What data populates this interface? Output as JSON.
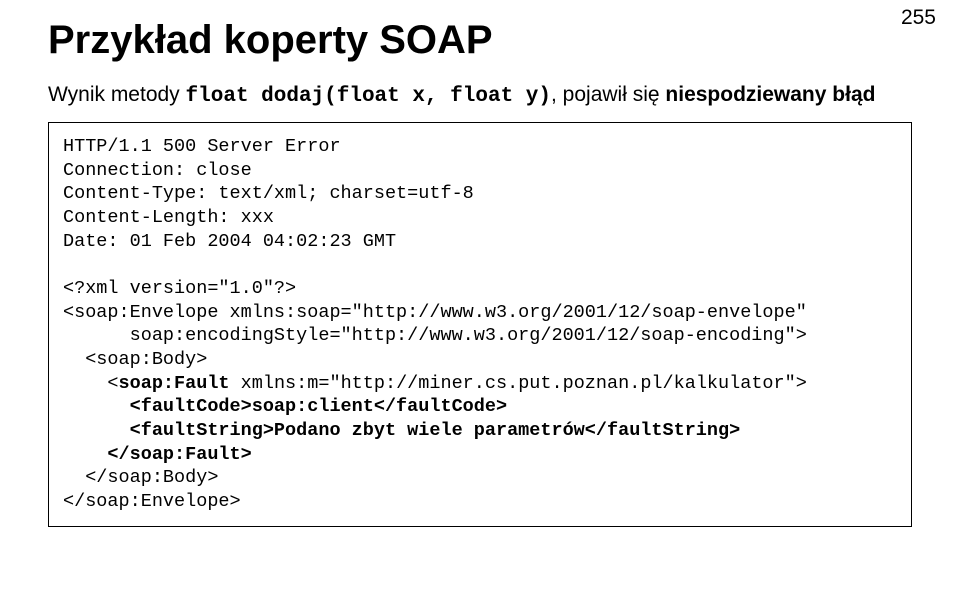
{
  "pageNumber": "255",
  "title": "Przykład koperty SOAP",
  "subtitle": {
    "prefix": "Wynik metody",
    "mono": "float dodaj(float x, float y)",
    "middle": ", pojawił się",
    "bold": "niespodziewany błąd"
  },
  "code": {
    "l1": "HTTP/1.1 500 Server Error",
    "l2": "Connection: close",
    "l3": "Content-Type: text/xml; charset=utf-8",
    "l4": "Content-Length: xxx",
    "l5": "Date: 01 Feb 2004 04:02:23 GMT",
    "l6": "",
    "l7": "<?xml version=\"1.0\"?>",
    "l8": "<soap:Envelope xmlns:soap=\"http://www.w3.org/2001/12/soap-envelope\"",
    "l9": "      soap:encodingStyle=\"http://www.w3.org/2001/12/soap-encoding\">",
    "l10": "  <soap:Body>",
    "l11a": "    <",
    "l11b": "soap:Fault",
    "l11c": " xmlns:m=\"http://miner.cs.put.poznan.pl/kalkulator\">",
    "l12": "      <faultCode>soap:client</faultCode>",
    "l13": "      <faultString>Podano zbyt wiele parametrów</faultString>",
    "l14": "    </soap:Fault>",
    "l15": "  </soap:Body>",
    "l16": "</soap:Envelope>"
  }
}
